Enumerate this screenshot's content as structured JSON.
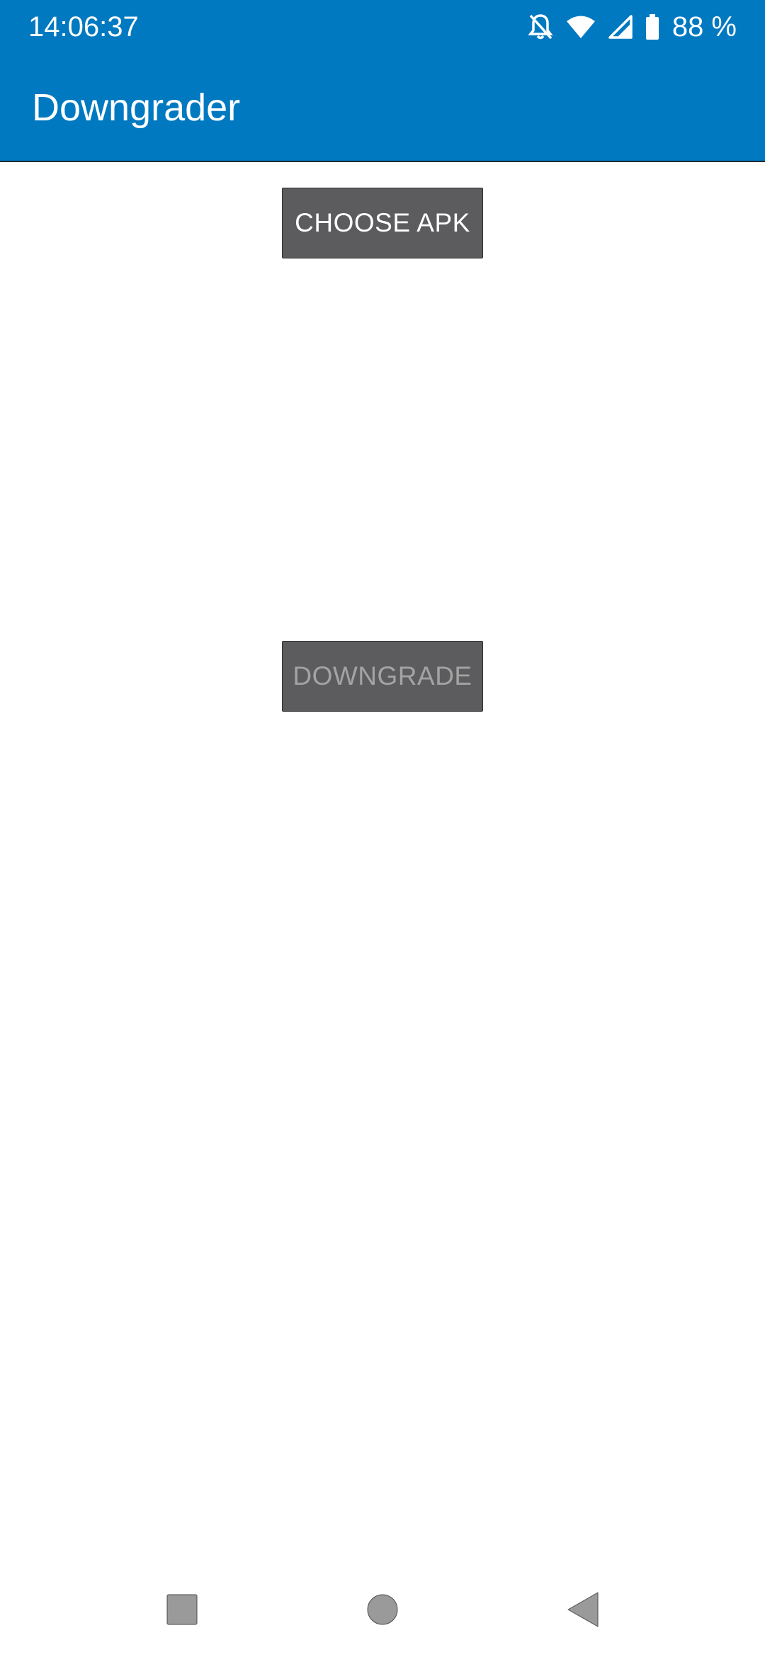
{
  "status_bar": {
    "time": "14:06:37",
    "battery_text": "88 %",
    "icons": [
      "notifications-off-icon",
      "wifi-icon",
      "cellular-signal-icon",
      "battery-icon"
    ]
  },
  "app_bar": {
    "title": "Downgrader",
    "color": "#0079c1"
  },
  "main": {
    "choose_apk_label": "CHOOSE APK",
    "downgrade_label": "DOWNGRADE",
    "downgrade_enabled": false
  },
  "nav_bar": {
    "icons": [
      "recents-square-icon",
      "home-circle-icon",
      "back-triangle-icon"
    ]
  }
}
